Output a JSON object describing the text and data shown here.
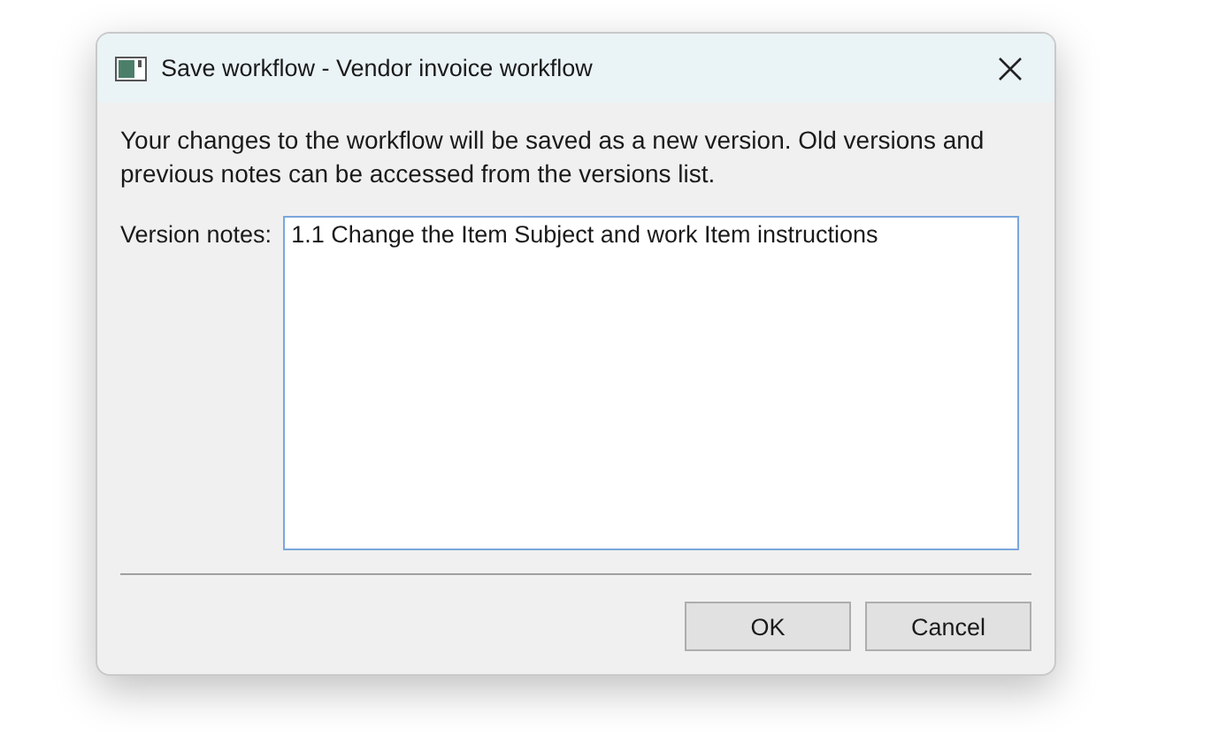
{
  "window": {
    "title": "Save workflow - Vendor invoice workflow"
  },
  "message": "Your changes to the workflow will be saved as a new version. Old versions and previous notes can be accessed from the versions list.",
  "notes": {
    "label": "Version notes:",
    "value": "1.1 Change the Item Subject and work Item instructions",
    "focused": true
  },
  "buttons": [
    {
      "label": "OK"
    },
    {
      "label": "Cancel"
    }
  ]
}
